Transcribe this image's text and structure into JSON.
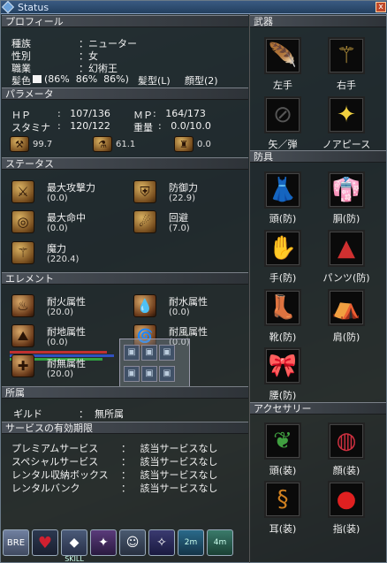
{
  "window": {
    "title": "Status",
    "close_label": "x"
  },
  "profile": {
    "header": "プロフィール",
    "race_label": "種族",
    "race_value": "：ニューター",
    "gender_label": "性別",
    "gender_value": "：女",
    "job_label": "職業",
    "job_value": "：幻術王",
    "hair_label": "髪色",
    "hair_value": "(86%  86%  86%)",
    "hairstyle": "髪型(L)",
    "face": "顔型(2)"
  },
  "params": {
    "header": "パラメータ",
    "hp_label": "ＨＰ",
    "hp_value": ":   107/136",
    "mp_label": "ＭＰ",
    "mp_value": ":   164/173",
    "stamina_label": "スタミナ",
    "stamina_value": ":   120/122",
    "weight_label": "重量",
    "weight_value": ":   0.0/10.0",
    "stat1": "99.7",
    "stat2": "61.1",
    "stat3": "0.0"
  },
  "status": {
    "header": "ステータス",
    "max_attack_label": "最大攻撃力",
    "max_attack_value": "(0.0)",
    "defense_label": "防御力",
    "defense_value": "(22.9)",
    "max_hit_label": "最大命中",
    "max_hit_value": "(0.0)",
    "evade_label": "回避",
    "evade_value": "(7.0)",
    "magic_label": "魔力",
    "magic_value": "(220.4)"
  },
  "element": {
    "header": "エレメント",
    "fire_label": "耐火属性",
    "fire_value": "(20.0)",
    "water_label": "耐水属性",
    "water_value": "(0.0)",
    "earth_label": "耐地属性",
    "earth_value": "(0.0)",
    "wind_label": "耐風属性",
    "wind_value": "(0.0)",
    "none_label": "耐無属性",
    "none_value": "(20.0)"
  },
  "affiliation": {
    "header": "所属",
    "guild_label": "ギルド",
    "guild_value": "：  無所属"
  },
  "services": {
    "header": "サービスの有効期限",
    "rows": [
      {
        "name": "プレミアムサービス",
        "value": "：   該当サービスなし"
      },
      {
        "name": "スペシャルサービス",
        "value": "：   該当サービスなし"
      },
      {
        "name": "レンタル収納ボックス",
        "value": "：   該当サービスなし"
      },
      {
        "name": "レンタルバンク",
        "value": "：   該当サービスなし"
      }
    ]
  },
  "weapons": {
    "header": "武器",
    "left_hand": "左手",
    "right_hand": "右手",
    "arrow": "矢／弾",
    "noa_piece": "ノアピース"
  },
  "armor": {
    "header": "防具",
    "head": "頭(防)",
    "body": "胴(防)",
    "hands": "手(防)",
    "pants": "パンツ(防)",
    "shoes": "靴(防)",
    "shoulder": "肩(防)",
    "waist": "腰(防)"
  },
  "accessory": {
    "header": "アクセサリー",
    "head": "頭(装)",
    "face": "顔(装)",
    "ear": "耳(装)",
    "finger": "指(装)"
  },
  "taskbar": {
    "bre_label": "BRE",
    "skill_label": "SKILL",
    "time1": "2m",
    "time2": "4m"
  }
}
